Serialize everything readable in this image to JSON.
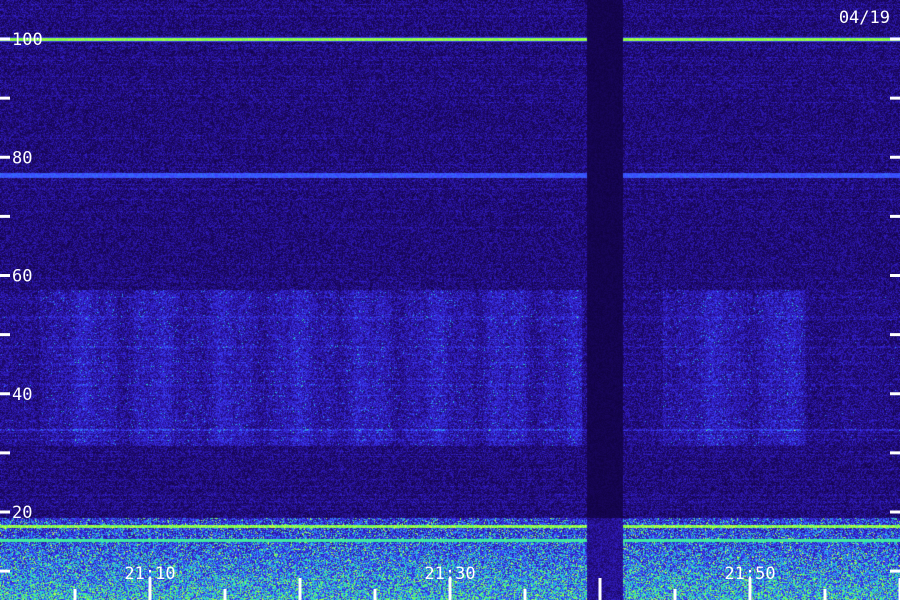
{
  "date_label": "04/19",
  "colors": {
    "background": "#14005c",
    "noise_dark": "#1a0a70",
    "noise_light": "#3a2ad0",
    "band_bright": "#2fe7c0",
    "band_violet": "#4a36ff",
    "signal_green": "#7cff3a",
    "tick": "#ffffff",
    "text": "#ffffff"
  },
  "chart_data": {
    "type": "heatmap",
    "title": "",
    "xlabel": "",
    "ylabel": "",
    "colormap": "blue-violet to cyan/green",
    "x_ticks": [
      "21:10",
      "21:30",
      "21:50"
    ],
    "y_ticks": [
      20,
      40,
      60,
      80,
      100
    ],
    "ylim": [
      0,
      100
    ],
    "grid": false,
    "features": [
      {
        "name": "steady carrier",
        "y": 100,
        "strength": "strong"
      },
      {
        "name": "weaker carrier",
        "y": 77,
        "strength": "medium"
      },
      {
        "name": "burst band",
        "y_range": [
          33,
          56
        ],
        "strength": "medium"
      },
      {
        "name": "low-frequency noise",
        "y_range": [
          0,
          19
        ],
        "strength": "strong"
      },
      {
        "name": "data gap",
        "x_range": [
          "21:39",
          "21:42"
        ]
      }
    ]
  }
}
